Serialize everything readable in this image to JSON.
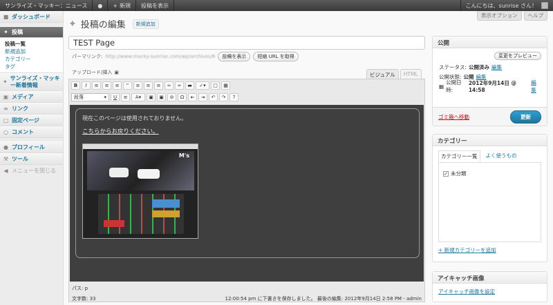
{
  "adminbar": {
    "site": "サンライズ・マッキー：ニュース",
    "comments_icon": "speech-bubble",
    "new": "新規",
    "view": "投稿を表示",
    "greeting": "こんにちは、sunrise さん！"
  },
  "screen_meta": {
    "options": "表示オプション",
    "help": "ヘルプ"
  },
  "sidebar": {
    "dashboard": "ダッシュボード",
    "posts": "投稿",
    "posts_sub": [
      "投稿一覧",
      "新規追加",
      "カテゴリー",
      "タグ"
    ],
    "sunrise": "サンライズ・マッキー新着情報",
    "media": "メディア",
    "links": "リンク",
    "pages": "固定ページ",
    "comments": "コメント",
    "profile": "プロフィール",
    "tools": "ツール",
    "collapse": "メニューを閉じる"
  },
  "page": {
    "title": "投稿の編集",
    "add_new": "新規追加",
    "post_title": "TEST Page",
    "permalink_label": "パーマリンク:",
    "permalink_url": "http://www.macky-sunrise.com/wp/archives/6",
    "view_post": "投稿を表示",
    "shortlink": "短縮 URL を取得",
    "upload_insert": "アップロード/挿入"
  },
  "editor": {
    "tab_visual": "ビジュアル",
    "tab_html": "HTML",
    "format_select": "段落",
    "content_line1": "現在このページは使用されておりません。",
    "content_line2": "こちらからお戻りください。",
    "path": "パス: p",
    "word_count": "文字数: 33",
    "saved": "12:00:54 pm に下書きを保存しました。 最後の編集: 2012年9月14日 2:58 PM - admin"
  },
  "publish": {
    "title": "公開",
    "preview": "変更をプレビュー",
    "status_label": "ステータス:",
    "status": "公開済み",
    "edit": "編集",
    "visibility_label": "公開状態:",
    "visibility": "公開",
    "date_label": "公開日時:",
    "date": "2012年9月14日 @ 14:58",
    "trash": "ゴミ箱へ移動",
    "update": "更新"
  },
  "categories": {
    "title": "カテゴリー",
    "tab_all": "カテゴリー一覧",
    "tab_popular": "よく使うもの",
    "items": [
      {
        "name": "未分類",
        "checked": true
      }
    ],
    "add_new": "+ 新規カテゴリーを追加"
  },
  "featured": {
    "title": "アイキャッチ画像",
    "set": "アイキャッチ画像を設定"
  },
  "thumb_logo": "M's"
}
